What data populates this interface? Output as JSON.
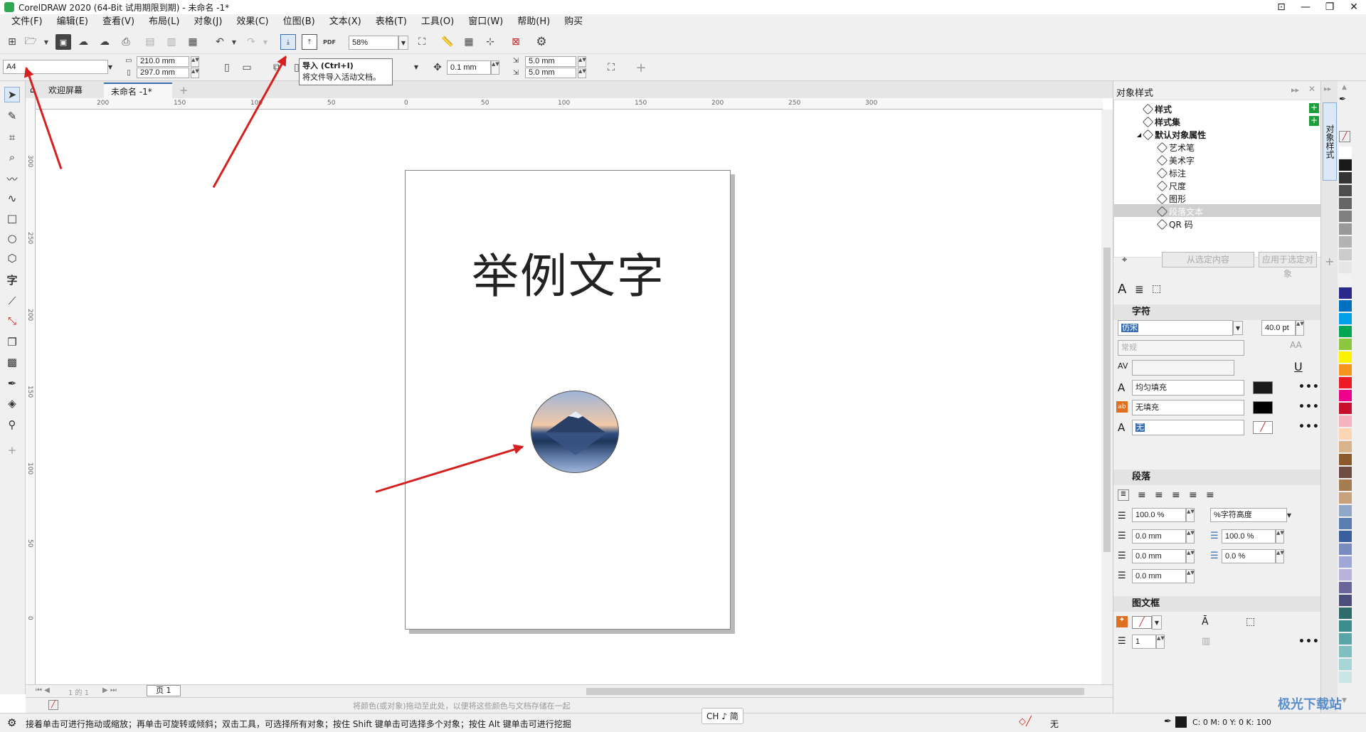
{
  "window": {
    "title": "CorelDRAW 2020 (64-Bit 试用期限到期) - 未命名 -1*"
  },
  "menu": [
    "文件(F)",
    "编辑(E)",
    "查看(V)",
    "布局(L)",
    "对象(J)",
    "效果(C)",
    "位图(B)",
    "文本(X)",
    "表格(T)",
    "工具(O)",
    "窗口(W)",
    "帮助(H)",
    "购买"
  ],
  "toolbar": {
    "zoom": "58%",
    "pdf_label": "PDF"
  },
  "propbar": {
    "page_size": "A4",
    "width": "210.0 mm",
    "height": "297.0 mm",
    "nudge": "0.1 mm",
    "dup_x": "5.0 mm",
    "dup_y": "5.0 mm"
  },
  "tooltip": {
    "title": "导入 (Ctrl+I)",
    "desc": "将文件导入活动文档。"
  },
  "tabs": {
    "welcome": "欢迎屏幕",
    "doc": "未命名 -1*"
  },
  "ruler": {
    "h_ticks": [
      "200",
      "150",
      "100",
      "50",
      "0",
      "50",
      "100",
      "150",
      "200",
      "250",
      "300"
    ],
    "v_ticks": [
      "300",
      "250",
      "200",
      "150",
      "100",
      "50",
      "0"
    ]
  },
  "document": {
    "text": "举例文字"
  },
  "page_nav": {
    "counter": "1 的 1",
    "page_tab": "页 1"
  },
  "palette_hint": "将颜色(或对象)拖动至此处，以便将这些颜色与文档存储在一起",
  "status": {
    "hint": "接着单击可进行拖动或缩放；再单击可旋转或倾斜；双击工具，可选择所有对象；按住 Shift 键单击可选择多个对象；按住 Alt 键单击可进行挖掘",
    "ime": "CH ♪ 简",
    "fill": "无",
    "cmyk": "C: 0 M: 0 Y: 0 K: 100"
  },
  "panel": {
    "title": "对象样式",
    "tree": [
      {
        "label": "样式",
        "bold": true
      },
      {
        "label": "样式集",
        "bold": true
      },
      {
        "label": "默认对象属性",
        "bold": true
      },
      {
        "label": "艺术笔"
      },
      {
        "label": "美术字"
      },
      {
        "label": "标注"
      },
      {
        "label": "尺度"
      },
      {
        "label": "图形"
      },
      {
        "label": "段落文本",
        "selected": true
      },
      {
        "label": "QR 码"
      }
    ],
    "btn_from": "从选定内容",
    "btn_apply": "应用于选定对象",
    "char": {
      "header": "字符",
      "font": "仿宋",
      "size": "40.0 pt",
      "style": "常规",
      "fill": "均匀填充",
      "bg": "无填充",
      "outline": "无"
    },
    "para": {
      "header": "段落",
      "spacing_pct": "100.0 %",
      "spacing_unit": "%字符高度",
      "indent1": "0.0 mm",
      "line_pct": "100.0 %",
      "indent2": "0.0 mm",
      "char_pct": "0.0 %",
      "indent3": "0.0 mm"
    },
    "frame": {
      "header": "图文框",
      "cols": "1"
    }
  },
  "dock": {
    "tab": "对象样式"
  },
  "colors": {
    "accent": "#d62020",
    "selection": "#3c6fb0",
    "palette": [
      "#ffffff",
      "#1a1a1a",
      "#333333",
      "#4d4d4d",
      "#666666",
      "#808080",
      "#999999",
      "#b3b3b3",
      "#cccccc",
      "#e6e6e6",
      "#f2f2f2",
      "#2a2a8c",
      "#0070c0",
      "#00a0e9",
      "#00a651",
      "#8dc63f",
      "#fff200",
      "#f7941d",
      "#ed1c24",
      "#ec008c",
      "#c8102e",
      "#f5b3c0",
      "#fcd5b5",
      "#d9b38c",
      "#8b5a2b",
      "#6d4c41",
      "#a67c52",
      "#c7a27c",
      "#8fa8c8",
      "#5b7db1",
      "#3a5f9e",
      "#7a8bbf",
      "#9ea7d6",
      "#b7b3d9",
      "#6b6699",
      "#4b4e7a",
      "#2e6b6b",
      "#3d8c8c",
      "#5aa6a6",
      "#7fbfbf",
      "#a8d5d5",
      "#c9e6e6"
    ]
  }
}
